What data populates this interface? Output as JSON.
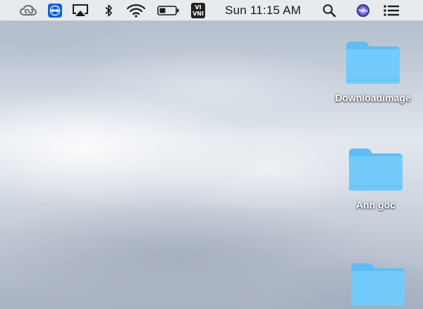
{
  "menubar": {
    "items": [
      {
        "name": "creative-cloud-icon"
      },
      {
        "name": "teamviewer-icon",
        "color": "#0e5fd8"
      },
      {
        "name": "airplay-icon"
      },
      {
        "name": "bluetooth-icon"
      },
      {
        "name": "wifi-icon"
      },
      {
        "name": "battery-icon"
      },
      {
        "name": "input-method-icon",
        "line1": "VI",
        "line2": "VNI"
      }
    ],
    "clock": "Sun 11:15 AM",
    "spotlight": {
      "name": "spotlight-search-icon"
    },
    "siri": {
      "name": "siri-icon"
    },
    "notifications": {
      "name": "notification-center-icon"
    }
  },
  "desktop": {
    "folders": [
      {
        "label": "Downloadimage"
      },
      {
        "label": "Anh goc"
      },
      {
        "label": ""
      }
    ],
    "folder_color": "#6cc6f7"
  }
}
